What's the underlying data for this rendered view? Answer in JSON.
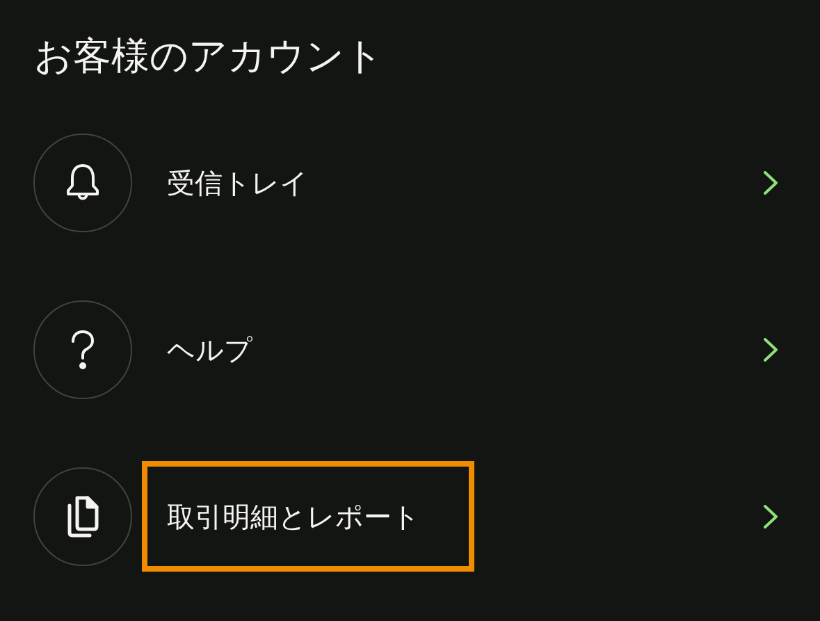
{
  "title": "お客様のアカウント",
  "items": [
    {
      "kind": "inbox",
      "label": "受信トレイ",
      "highlighted": false
    },
    {
      "kind": "help",
      "label": "ヘルプ",
      "highlighted": false
    },
    {
      "kind": "statements",
      "label": "取引明細とレポート",
      "highlighted": true
    }
  ]
}
